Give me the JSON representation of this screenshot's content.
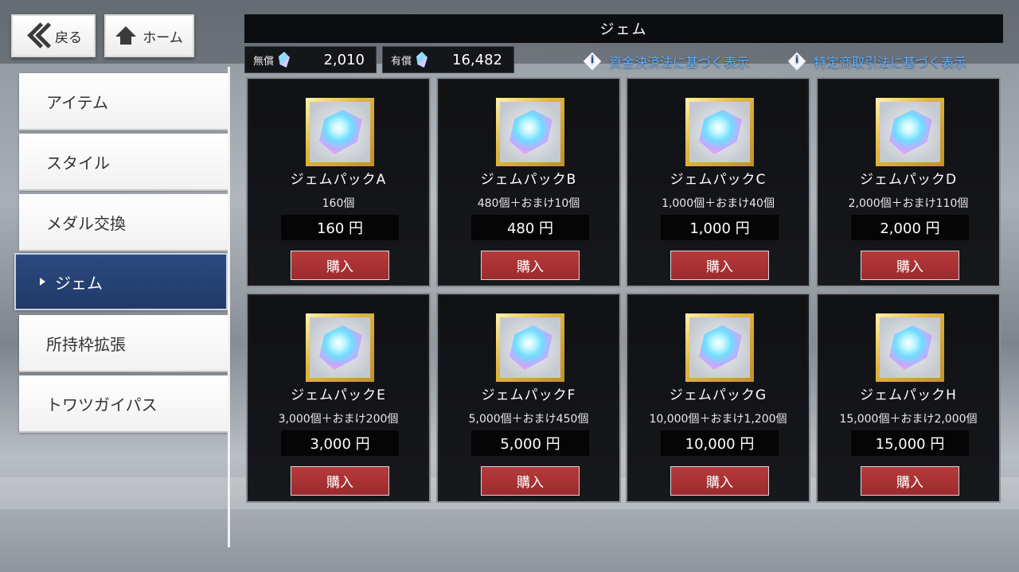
{
  "nav": {
    "back_label": "戻る",
    "home_label": "ホーム"
  },
  "header": {
    "title": "ジェム"
  },
  "balance": {
    "free_label": "無償",
    "free_value": "2,010",
    "paid_label": "有償",
    "paid_value": "16,482"
  },
  "legal": {
    "payment_services": "資金決済法に基づく表示",
    "commercial_transactions": "特定商取引法に基づく表示"
  },
  "sidebar": {
    "items": [
      {
        "label": "アイテム"
      },
      {
        "label": "スタイル"
      },
      {
        "label": "メダル交換"
      },
      {
        "label": "ジェム",
        "active": true
      },
      {
        "label": "所持枠拡張"
      },
      {
        "label": "トワツガイパス"
      }
    ]
  },
  "buy_label": "購入",
  "products": [
    {
      "name": "ジェムパックA",
      "amount": "160個",
      "price": "160 円"
    },
    {
      "name": "ジェムパックB",
      "amount": "480個＋おまけ10個",
      "price": "480 円"
    },
    {
      "name": "ジェムパックC",
      "amount": "1,000個＋おまけ40個",
      "price": "1,000 円"
    },
    {
      "name": "ジェムパックD",
      "amount": "2,000個＋おまけ110個",
      "price": "2,000 円"
    },
    {
      "name": "ジェムパックE",
      "amount": "3,000個＋おまけ200個",
      "price": "3,000 円"
    },
    {
      "name": "ジェムパックF",
      "amount": "5,000個＋おまけ450個",
      "price": "5,000 円"
    },
    {
      "name": "ジェムパックG",
      "amount": "10,000個＋おまけ1,200個",
      "price": "10,000 円"
    },
    {
      "name": "ジェムパックH",
      "amount": "15,000個＋おまけ2,000個",
      "price": "15,000 円"
    }
  ]
}
